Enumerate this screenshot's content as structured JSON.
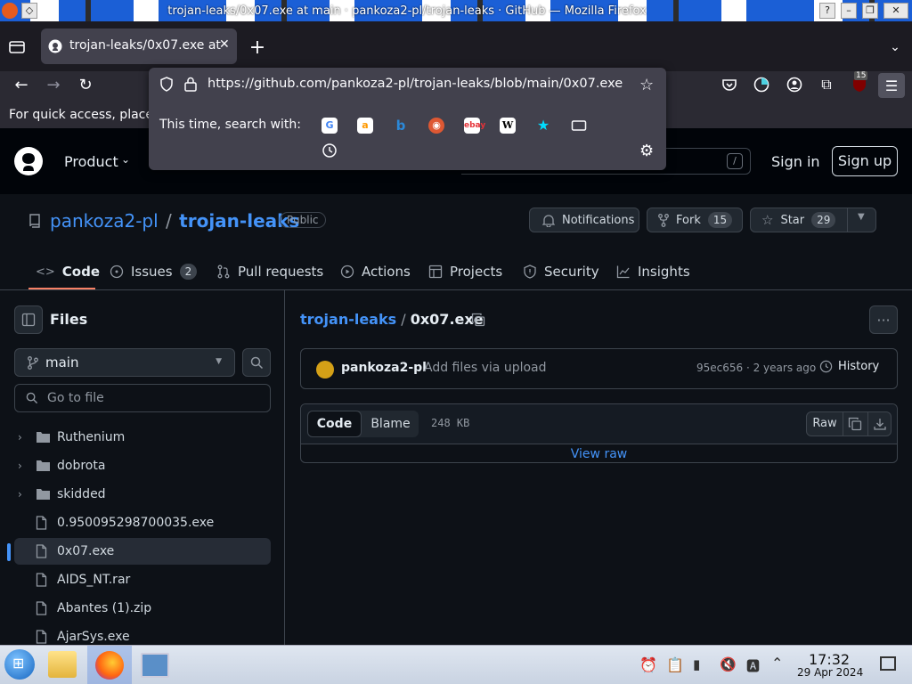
{
  "window": {
    "title": "trojan-leaks/0x07.exe at main · pankoza2-pl/trojan-leaks · GitHub — Mozilla Firefox"
  },
  "browser": {
    "tab_title": "trojan-leaks/0x07.exe at",
    "url": "https://github.com/pankoza2-pl/trojan-leaks/blob/main/0x07.exe",
    "search_with": "This time, search with:",
    "bookmarks_hint": "For quick access, place",
    "extensions_badge": "15",
    "engines": [
      "google-icon",
      "amazon-icon",
      "bing-icon",
      "duckduckgo-icon",
      "ebay-icon",
      "wikipedia-icon",
      "bookmarks-star-icon",
      "tabs-icon",
      "history-icon"
    ]
  },
  "github": {
    "nav": {
      "product": "Product",
      "sign_in": "Sign in",
      "sign_up": "Sign up",
      "search_key": "/"
    },
    "repo": {
      "owner": "pankoza2-pl",
      "name": "trojan-leaks",
      "visibility": "Public",
      "notifications": "Notifications",
      "fork": "Fork",
      "fork_count": "15",
      "star": "Star",
      "star_count": "29"
    },
    "tabs": [
      {
        "label": "Code"
      },
      {
        "label": "Issues",
        "count": "2"
      },
      {
        "label": "Pull requests"
      },
      {
        "label": "Actions"
      },
      {
        "label": "Projects"
      },
      {
        "label": "Security"
      },
      {
        "label": "Insights"
      }
    ],
    "sidebar": {
      "title": "Files",
      "branch": "main",
      "go_to_file": "Go to file",
      "items": [
        {
          "type": "dir",
          "name": "Ruthenium"
        },
        {
          "type": "dir",
          "name": "dobrota"
        },
        {
          "type": "dir",
          "name": "skidded"
        },
        {
          "type": "file",
          "name": "0.950095298700035.exe"
        },
        {
          "type": "file",
          "name": "0x07.exe"
        },
        {
          "type": "file",
          "name": "AIDS_NT.rar"
        },
        {
          "type": "file",
          "name": "Abantes (1).zip"
        },
        {
          "type": "file",
          "name": "AjarSys.exe"
        }
      ]
    },
    "file": {
      "repo": "trojan-leaks",
      "sep": "/",
      "name": "0x07.exe",
      "commit_author": "pankoza2-pl",
      "commit_msg": "Add files via upload",
      "commit_meta": "95ec656 · 2 years ago",
      "history": "History",
      "code_tab": "Code",
      "blame_tab": "Blame",
      "size": "248 KB",
      "raw": "Raw",
      "view_raw": "View raw"
    }
  },
  "taskbar": {
    "time": "17:32",
    "date": "29 Apr 2024"
  },
  "colors": {
    "accent": "#4493f8",
    "selected_underline": "#f78166",
    "bg": "#0d1117"
  }
}
